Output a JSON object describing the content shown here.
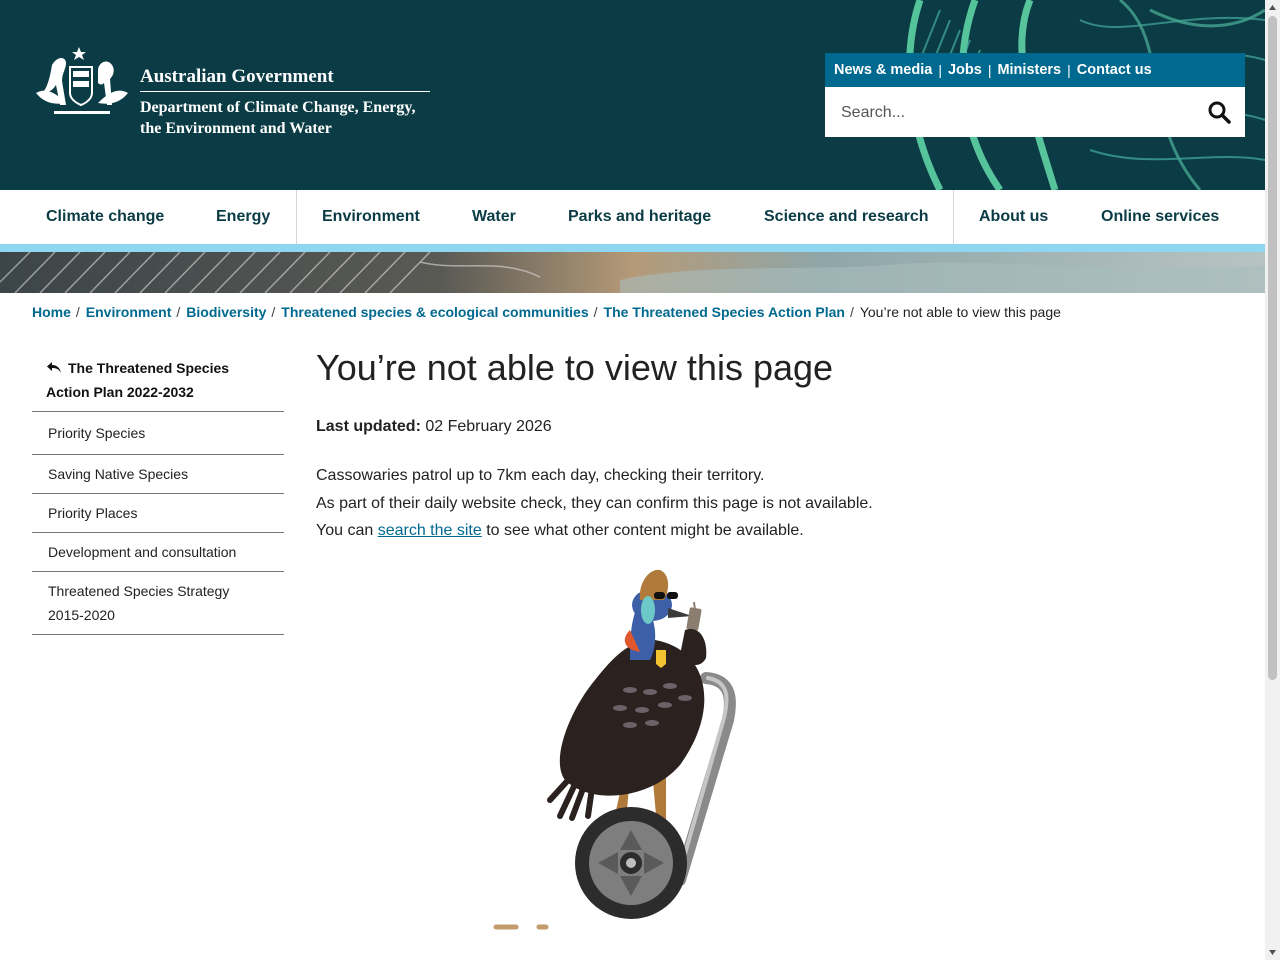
{
  "header": {
    "gov_title": "Australian Government",
    "department": "Department of Climate Change, Energy, the Environment and Water",
    "utility_links": [
      "News & media",
      "Jobs",
      "Ministers",
      "Contact us"
    ],
    "search_placeholder": "Search..."
  },
  "nav": [
    "Climate change",
    "Energy",
    "Environment",
    "Water",
    "Parks and heritage",
    "Science and research",
    "About us",
    "Online services"
  ],
  "breadcrumb": {
    "links": [
      "Home",
      "Environment",
      "Biodiversity",
      "Threatened species & ecological communities",
      "The Threatened Species Action Plan"
    ],
    "current": "You’re not able to view this page"
  },
  "sidebar": {
    "parent": "The Threatened Species Action Plan 2022-2032",
    "items": [
      "Priority Species",
      "Saving Native Species",
      "Priority Places",
      "Development and consultation",
      "Threatened Species Strategy 2015-2020"
    ]
  },
  "content": {
    "title": "You’re not able to view this page",
    "updated_label": "Last updated:",
    "updated_date": "02 February 2026",
    "para1": "Cassowaries patrol up to 7km each day, checking their territory.",
    "para2": "As part of their daily website check, they can confirm this page is not available.",
    "para3_before": "You can",
    "para3_link": "search the site",
    "para3_after": "to see what other content might be available."
  },
  "colors": {
    "header_bg": "#0b3c45",
    "utility_bar": "#00698f",
    "nav_accent": "#8fd6f0",
    "link": "#00698f",
    "header_art": "#5fd3a5"
  }
}
